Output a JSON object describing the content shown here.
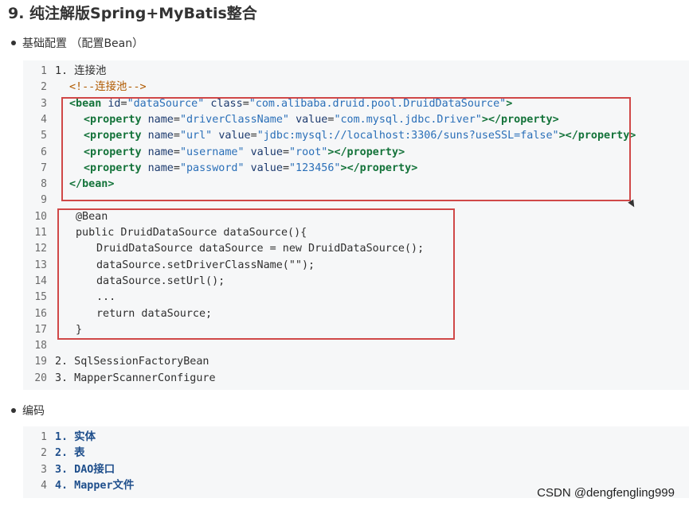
{
  "heading": "9. 纯注解版Spring+MyBatis整合",
  "sections": [
    {
      "bullet": "基础配置 （配置Bean）"
    },
    {
      "bullet": "编码"
    }
  ],
  "code1": [
    {
      "n": "1",
      "t": "1. 连接池"
    },
    {
      "n": "2",
      "t": "<!--连接池-->"
    },
    {
      "n": "3",
      "t": "<bean id=\"dataSource\" class=\"com.alibaba.druid.pool.DruidDataSource\">"
    },
    {
      "n": "4",
      "t": "<property name=\"driverClassName\" value=\"com.mysql.jdbc.Driver\"></property>"
    },
    {
      "n": "5",
      "t": "<property name=\"url\" value=\"jdbc:mysql://localhost:3306/suns?useSSL=false\"></property>"
    },
    {
      "n": "6",
      "t": "<property name=\"username\" value=\"root\"></property>"
    },
    {
      "n": "7",
      "t": "<property name=\"password\" value=\"123456\"></property>"
    },
    {
      "n": "8",
      "t": "</bean>"
    },
    {
      "n": "9",
      "t": ""
    },
    {
      "n": "10",
      "t": "@Bean"
    },
    {
      "n": "11",
      "t": "public DruidDataSource dataSource(){"
    },
    {
      "n": "12",
      "t": "DruidDataSource dataSource = new DruidDataSource();"
    },
    {
      "n": "13",
      "t": "dataSource.setDriverClassName(\"\");"
    },
    {
      "n": "14",
      "t": "dataSource.setUrl();"
    },
    {
      "n": "15",
      "t": "..."
    },
    {
      "n": "16",
      "t": "return dataSource;"
    },
    {
      "n": "17",
      "t": "}"
    },
    {
      "n": "18",
      "t": ""
    },
    {
      "n": "19",
      "t": "2. SqlSessionFactoryBean"
    },
    {
      "n": "20",
      "t": "3. MapperScannerConfigure"
    }
  ],
  "code2": [
    {
      "n": "1",
      "t": "1. 实体"
    },
    {
      "n": "2",
      "t": "2. 表"
    },
    {
      "n": "3",
      "t": "3. DAO接口"
    },
    {
      "n": "4",
      "t": "4. Mapper文件"
    }
  ],
  "watermark": "CSDN @dengfengling999",
  "colors": {
    "highlight_box": "#d04848",
    "code_bg": "#f6f7f8",
    "tag": "#14733a",
    "string": "#2a6fb8",
    "comment": "#b05a00"
  }
}
